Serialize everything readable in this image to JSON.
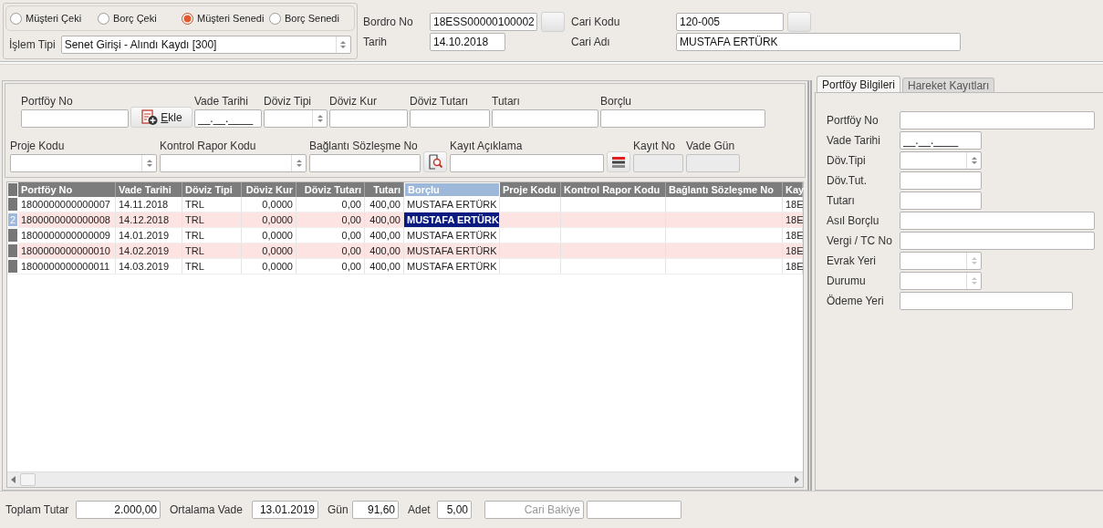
{
  "selection_group": {
    "options": [
      {
        "label": "Müşteri Çeki",
        "selected": false
      },
      {
        "label": "Borç Çeki",
        "selected": false
      },
      {
        "label": "Müşteri Senedi",
        "selected": true
      },
      {
        "label": "Borç Senedi",
        "selected": false
      }
    ],
    "islem_tipi": {
      "label": "İşlem Tipi",
      "value": "Senet Girişi - Alındı Kaydı [300]"
    }
  },
  "header": {
    "bordro_no": {
      "label": "Bordro No",
      "value": "18ESS00000100002"
    },
    "tarih": {
      "label": "Tarih",
      "value": "14.10.2018"
    },
    "cari_kodu": {
      "label": "Cari Kodu",
      "value": "120-005"
    },
    "cari_adi": {
      "label": "Cari Adı",
      "value": "MUSTAFA ERTÜRK"
    }
  },
  "entry_form": {
    "row_1": [
      {
        "kind": "field",
        "label": "Portföy No"
      },
      {
        "kind": "button",
        "label": "Ekle"
      },
      {
        "kind": "date",
        "label": "Vade Tarihi",
        "value": "__.__.____"
      },
      {
        "kind": "combo",
        "label": "Döviz Tipi"
      },
      {
        "kind": "field",
        "label": "Döviz Kur"
      },
      {
        "kind": "field",
        "label": "Döviz Tutarı"
      },
      {
        "kind": "field",
        "label": "Tutarı"
      },
      {
        "kind": "field",
        "label": "Borçlu"
      }
    ],
    "row_2": [
      {
        "kind": "combo",
        "label": "Proje Kodu"
      },
      {
        "kind": "combo",
        "label": "Kontrol Rapor Kodu"
      },
      {
        "kind": "lookup",
        "label": "Bağlantı Sözleşme No"
      },
      {
        "kind": "menu",
        "label": "Kayıt Açıklama"
      },
      {
        "kind": "readonly",
        "label": "Kayıt No"
      },
      {
        "kind": "readonly",
        "label": "Vade Gün"
      }
    ]
  },
  "table": {
    "columns": [
      {
        "label": "Portföy No",
        "kind": "text",
        "selected": false
      },
      {
        "label": "Vade Tarihi",
        "kind": "text",
        "selected": false
      },
      {
        "label": "Döviz Tipi",
        "kind": "text",
        "selected": false
      },
      {
        "label": "Döviz Kur",
        "kind": "number",
        "selected": false
      },
      {
        "label": "Döviz Tutarı",
        "kind": "number",
        "selected": false
      },
      {
        "label": "Tutarı",
        "kind": "number",
        "selected": false
      },
      {
        "label": "Borçlu",
        "kind": "text",
        "selected": true
      },
      {
        "label": "Proje Kodu",
        "kind": "text",
        "selected": false
      },
      {
        "label": "Kontrol Rapor Kodu",
        "kind": "text",
        "selected": false
      },
      {
        "label": "Bağlantı Sözleşme No",
        "kind": "text",
        "selected": false
      },
      {
        "label": "Kay",
        "kind": "text",
        "selected": false
      }
    ],
    "rows": [
      {
        "selected": false,
        "cells": [
          "1800000000000007",
          "14.11.2018",
          "TRL",
          "0,0000",
          "0,00",
          "400,00",
          "MUSTAFA ERTÜRK",
          "",
          "",
          "",
          "18E"
        ]
      },
      {
        "selected": true,
        "row_number": "2",
        "cells": [
          "1800000000000008",
          "14.12.2018",
          "TRL",
          "0,0000",
          "0,00",
          "400,00",
          "MUSTAFA ERTÜRK",
          "",
          "",
          "",
          "18E"
        ]
      },
      {
        "selected": false,
        "cells": [
          "1800000000000009",
          "14.01.2019",
          "TRL",
          "0,0000",
          "0,00",
          "400,00",
          "MUSTAFA ERTÜRK",
          "",
          "",
          "",
          "18E"
        ]
      },
      {
        "selected": false,
        "cells": [
          "1800000000000010",
          "14.02.2019",
          "TRL",
          "0,0000",
          "0,00",
          "400,00",
          "MUSTAFA ERTÜRK",
          "",
          "",
          "",
          "18E"
        ]
      },
      {
        "selected": false,
        "cells": [
          "1800000000000011",
          "14.03.2019",
          "TRL",
          "0,0000",
          "0,00",
          "400,00",
          "MUSTAFA ERTÜRK",
          "",
          "",
          "",
          "18E"
        ]
      }
    ]
  },
  "side_panel": {
    "tabs": [
      {
        "label": "Portföy Bilgileri",
        "selected": true
      },
      {
        "label": "Hareket Kayıtları",
        "selected": false
      }
    ],
    "fields": [
      {
        "kind": "field",
        "label": "Portföy No"
      },
      {
        "kind": "date",
        "label": "Vade Tarihi",
        "value": "__.__.____"
      },
      {
        "kind": "combo",
        "label": "Döv.Tipi"
      },
      {
        "kind": "field",
        "label": "Döv.Tut."
      },
      {
        "kind": "field",
        "label": "Tutarı"
      },
      {
        "kind": "field",
        "label": "Asıl Borçlu"
      },
      {
        "kind": "field",
        "label": "Vergi / TC No"
      },
      {
        "kind": "combo",
        "label": "Evrak Yeri",
        "disabled": true
      },
      {
        "kind": "combo",
        "label": "Durumu",
        "disabled": true
      },
      {
        "kind": "field",
        "label": "Ödeme Yeri"
      }
    ]
  },
  "footer": [
    {
      "label": "Toplam Tutar",
      "value": "2.000,00"
    },
    {
      "label": "Ortalama Vade",
      "value": "13.01.2019"
    },
    {
      "label": "Gün",
      "value": "91,60"
    },
    {
      "label": "Adet",
      "value": "5,00"
    },
    {
      "placeholder": "Cari Bakiye"
    }
  ]
}
